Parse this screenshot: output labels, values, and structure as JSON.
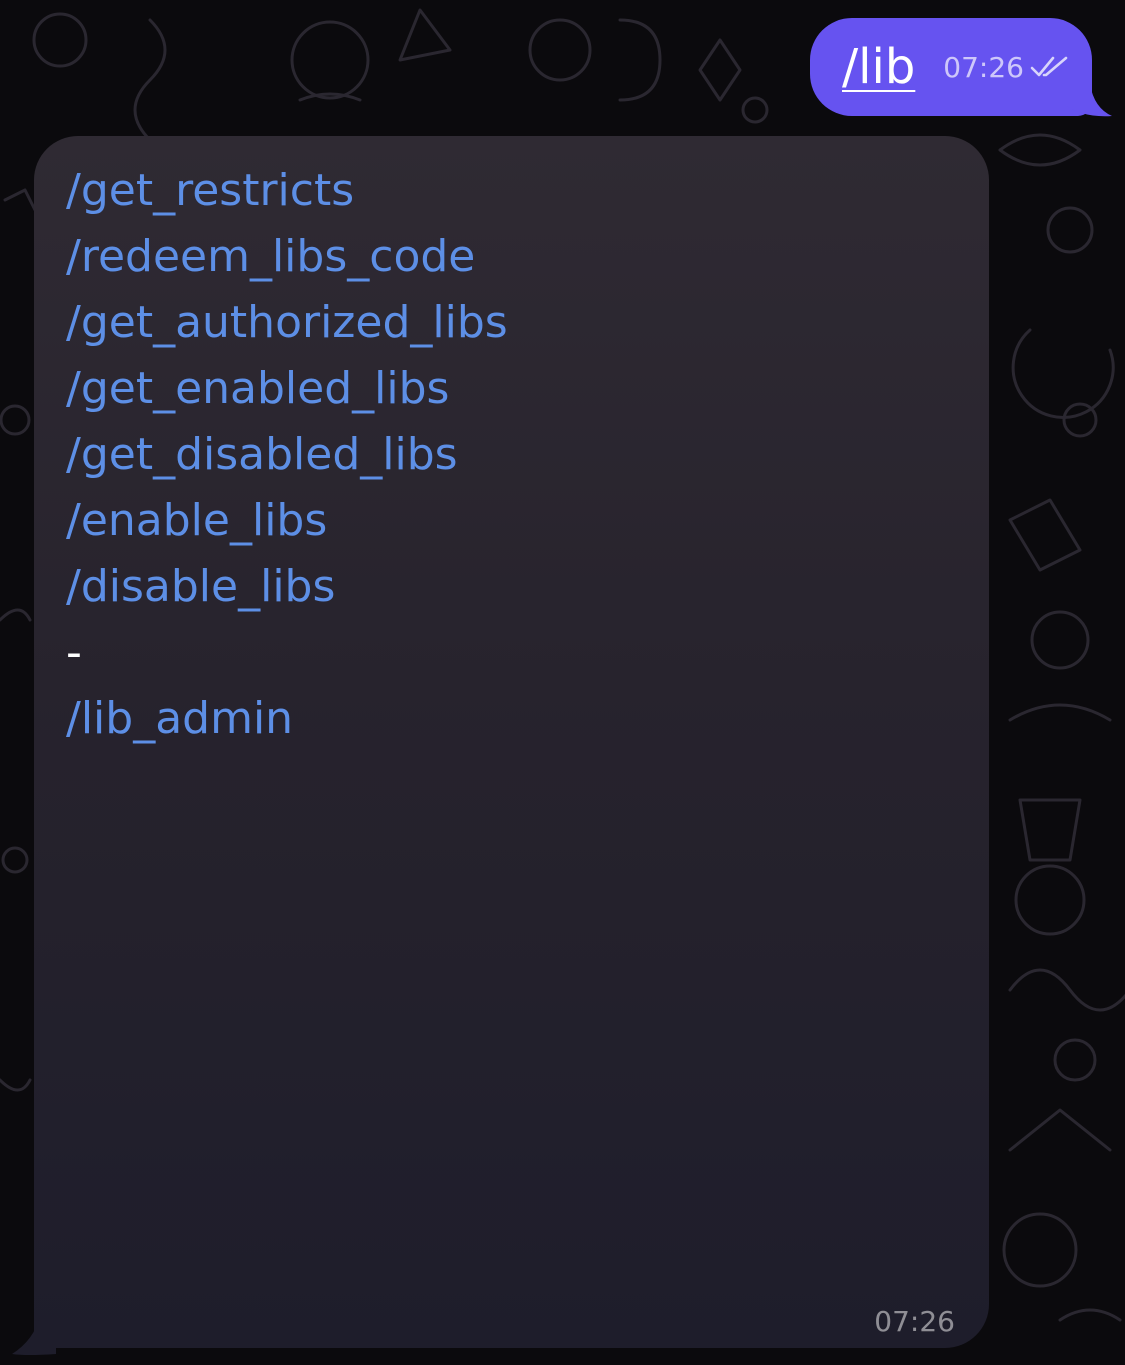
{
  "chat": {
    "outgoing": {
      "text": "/lib",
      "time": "07:26",
      "status_icon": "double-check-icon",
      "bubble_color": "#6653f0"
    },
    "incoming": {
      "time": "07:26",
      "bubble_color": "#2a2630",
      "command_color": "#5d8fe6",
      "lines": [
        {
          "cmd": "",
          "text": ""
        },
        {
          "cmd": "/get_restricts",
          "text": ""
        },
        {
          "cmd": "",
          "text": ""
        },
        {
          "cmd": "/redeem_libs_code",
          "text": ""
        },
        {
          "cmd": "",
          "text": ""
        },
        {
          "cmd": "/get_authorized_libs",
          "text": ""
        },
        {
          "cmd": "",
          "text": ""
        },
        {
          "cmd": "/get_enabled_libs",
          "text": ""
        },
        {
          "cmd": "",
          "text": ""
        },
        {
          "cmd": "/get_disabled_libs",
          "text": ""
        },
        {
          "cmd": "",
          "text": ""
        },
        {
          "cmd": "/enable_libs",
          "text": ""
        },
        {
          "cmd": "",
          "text": ""
        },
        {
          "cmd": "/disable_libs",
          "text": ""
        },
        {
          "cmd": "",
          "text": ""
        },
        {
          "cmd": "",
          "text": "-"
        },
        {
          "cmd": "",
          "text": ""
        },
        {
          "cmd": "/lib_admin",
          "text": ""
        }
      ]
    }
  }
}
